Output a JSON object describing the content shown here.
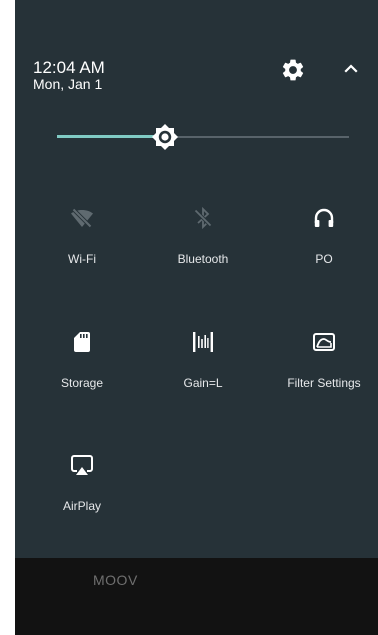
{
  "status": {
    "time": "12:04 AM",
    "date": "Mon, Jan 1"
  },
  "header": {
    "settings_icon": "gear-icon",
    "collapse_icon": "chevron-up-icon"
  },
  "brightness": {
    "level": 0.37,
    "icon": "brightness-icon"
  },
  "tiles": [
    {
      "label": "Wi-Fi",
      "icon": "wifi-off-icon",
      "enabled": false
    },
    {
      "label": "Bluetooth",
      "icon": "bluetooth-disabled-icon",
      "enabled": false
    },
    {
      "label": "PO",
      "icon": "headphones-icon",
      "enabled": true
    },
    {
      "label": "Storage",
      "icon": "sd-card-icon",
      "enabled": true
    },
    {
      "label": "Gain=L",
      "icon": "gain-icon",
      "enabled": true
    },
    {
      "label": "Filter Settings",
      "icon": "filter-settings-icon",
      "enabled": true
    },
    {
      "label": "AirPlay",
      "icon": "airplay-icon",
      "enabled": true
    }
  ],
  "footer": {
    "app_label": "MOOV"
  },
  "colors": {
    "shade_bg": "#263238",
    "accent": "#80cbc4",
    "icon_on": "#ffffff",
    "icon_off": "#5f6a70"
  }
}
